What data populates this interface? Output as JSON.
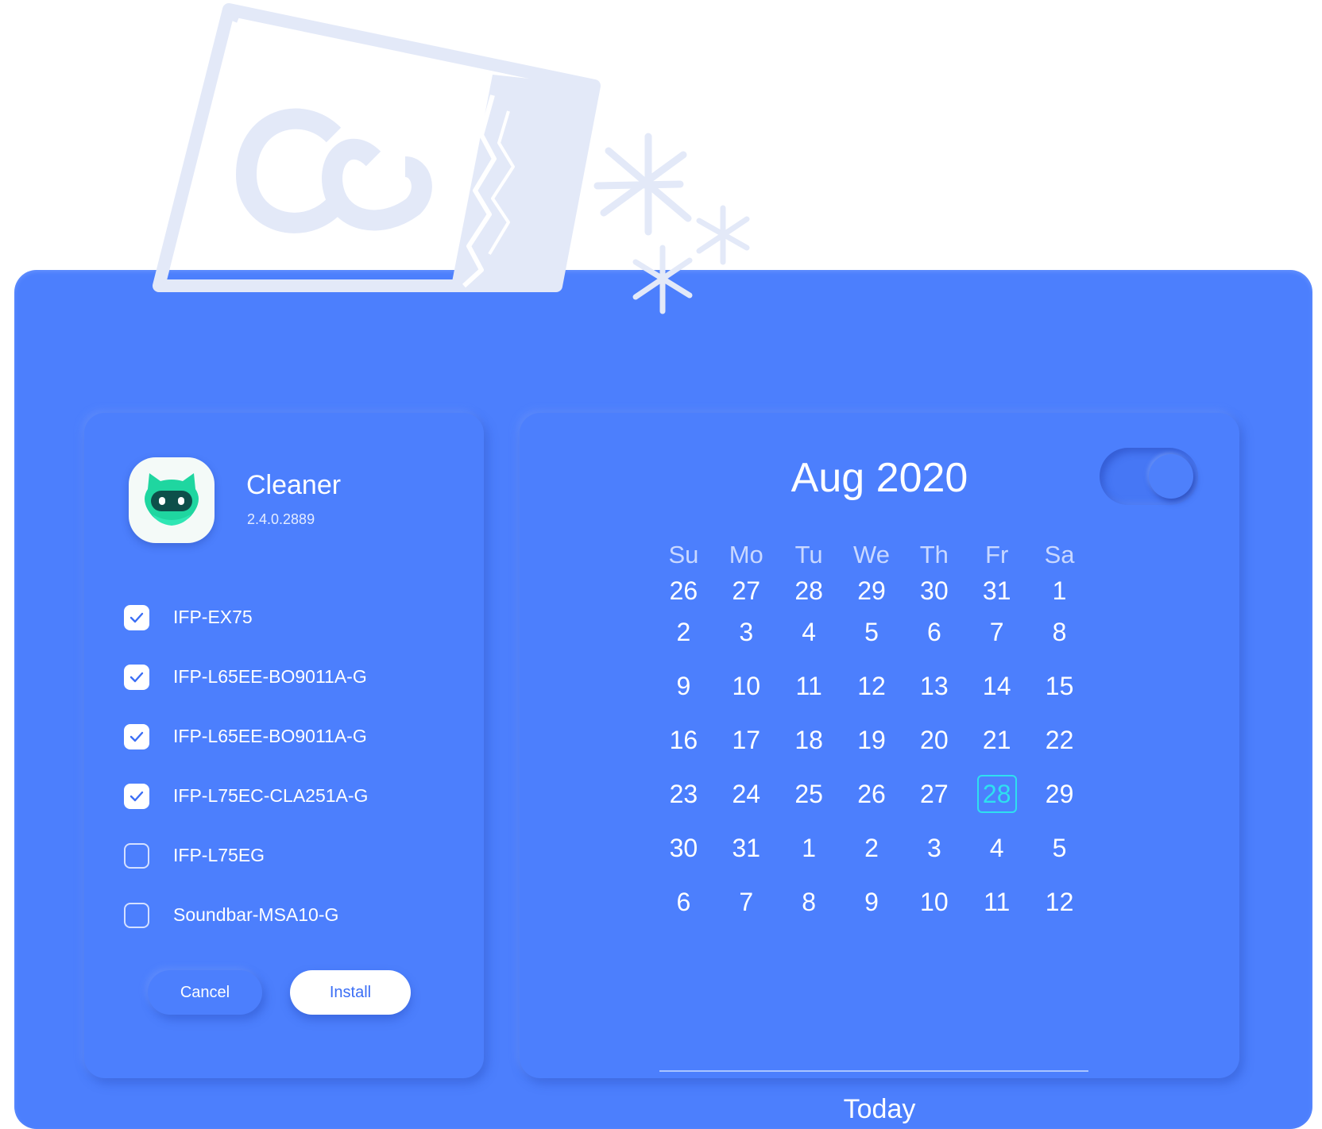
{
  "app": {
    "name": "Cleaner",
    "version": "2.4.0.2889",
    "icon": "cat-robot-icon"
  },
  "devices": [
    {
      "label": "IFP-EX75",
      "checked": true
    },
    {
      "label": "IFP-L65EE-BO9011A-G",
      "checked": true
    },
    {
      "label": "IFP-L65EE-BO9011A-G",
      "checked": true
    },
    {
      "label": "IFP-L75EC-CLA251A-G",
      "checked": true
    },
    {
      "label": "IFP-L75EG",
      "checked": false
    },
    {
      "label": "Soundbar-MSA10-G",
      "checked": false
    }
  ],
  "actions": {
    "cancel_label": "Cancel",
    "install_label": "Install"
  },
  "calendar": {
    "title": "Aug 2020",
    "toggle_on": true,
    "weekdays": [
      "Su",
      "Mo",
      "Tu",
      "We",
      "Th",
      "Fr",
      "Sa"
    ],
    "weeks": [
      [
        "26",
        "27",
        "28",
        "29",
        "30",
        "31",
        "1"
      ],
      [
        "2",
        "3",
        "4",
        "5",
        "6",
        "7",
        "8"
      ],
      [
        "9",
        "10",
        "11",
        "12",
        "13",
        "14",
        "15"
      ],
      [
        "16",
        "17",
        "18",
        "19",
        "20",
        "21",
        "22"
      ],
      [
        "23",
        "24",
        "25",
        "26",
        "27",
        "28",
        "29"
      ],
      [
        "30",
        "31",
        "1",
        "2",
        "3",
        "4",
        "5"
      ],
      [
        "6",
        "7",
        "8",
        "9",
        "10",
        "11",
        "12"
      ]
    ],
    "selected_day": "28",
    "today_label": "Today"
  },
  "colors": {
    "panel": "#4c7ffd",
    "accent": "#2ee0f0",
    "icon_green": "#1fd6a0",
    "decoration": "#e3e9f8"
  }
}
